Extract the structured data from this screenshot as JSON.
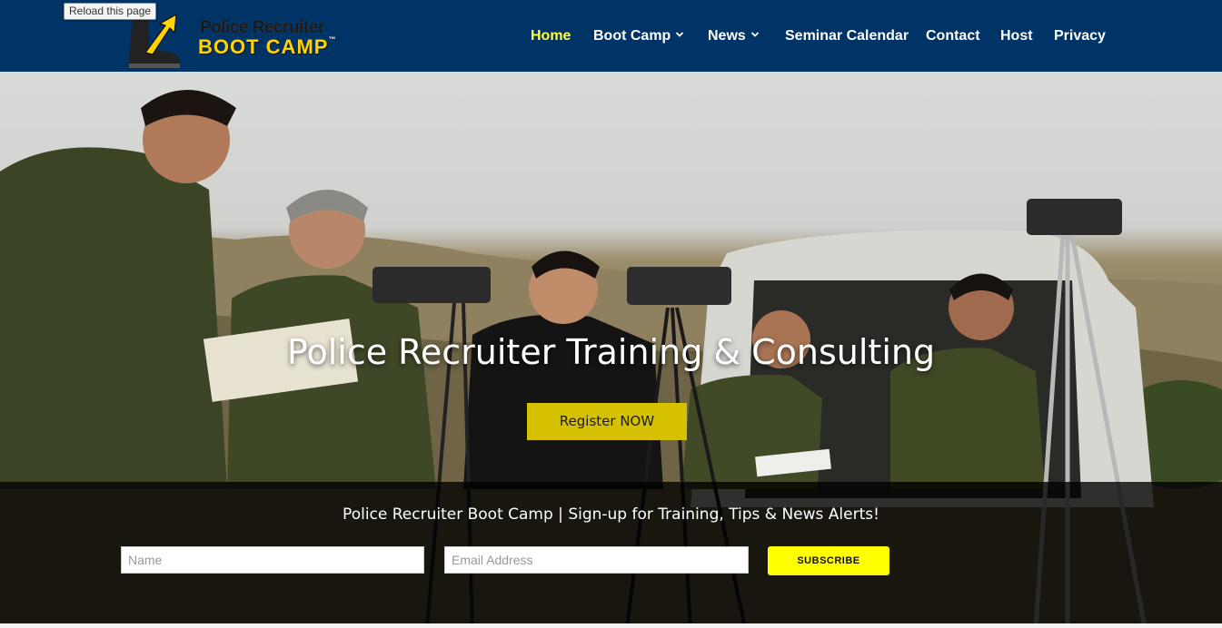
{
  "tooltip": "Reload this page",
  "logo": {
    "line1": "Police Recruiter",
    "line2": "BOOT CAMP",
    "tm": "™"
  },
  "nav": {
    "items": [
      {
        "label": "Home",
        "active": true,
        "dropdown": false
      },
      {
        "label": "Boot Camp",
        "active": false,
        "dropdown": true
      },
      {
        "label": "News",
        "active": false,
        "dropdown": true
      },
      {
        "label": "Seminar Calendar",
        "active": false,
        "dropdown": false
      },
      {
        "label": "Contact",
        "active": false,
        "dropdown": false
      },
      {
        "label": "Host",
        "active": false,
        "dropdown": false
      },
      {
        "label": "Privacy",
        "active": false,
        "dropdown": false
      }
    ]
  },
  "hero": {
    "title": "Police Recruiter Training & Consulting",
    "register_label": "Register NOW"
  },
  "signup": {
    "title": "Police Recruiter Boot Camp | Sign-up for Training, Tips & News Alerts!",
    "name_placeholder": "Name",
    "email_placeholder": "Email Address",
    "subscribe_label": "SUBSCRIBE"
  },
  "colors": {
    "header_bg": "#003366",
    "nav_active": "#ffff44",
    "register_bg": "#d6c100",
    "subscribe_bg": "#ffff00"
  }
}
